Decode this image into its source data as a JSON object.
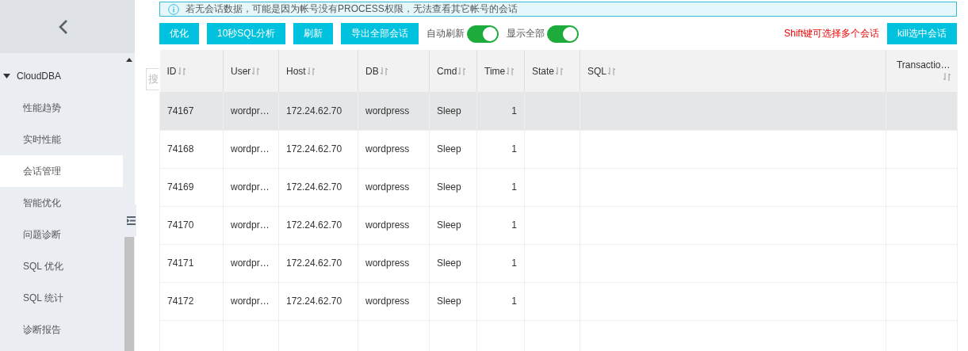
{
  "sidebar": {
    "group": {
      "label": "CloudDBA",
      "expanded": true
    },
    "items": [
      {
        "label": "性能趋势",
        "selected": false
      },
      {
        "label": "实时性能",
        "selected": false
      },
      {
        "label": "会话管理",
        "selected": true
      },
      {
        "label": "智能优化",
        "selected": false
      },
      {
        "label": "问题诊断",
        "selected": false
      },
      {
        "label": "SQL 优化",
        "selected": false
      },
      {
        "label": "SQL 统计",
        "selected": false
      },
      {
        "label": "诊断报告",
        "selected": false
      }
    ]
  },
  "search": {
    "placeholder": "搜"
  },
  "alert": {
    "text": "若无会话数据，可能是因为帐号没有PROCESS权限，无法查看其它帐号的会话"
  },
  "toolbar": {
    "buttons": [
      "优化",
      "10秒SQL分析",
      "刷新",
      "导出全部会话"
    ],
    "toggles": [
      {
        "label": "自动刷新",
        "on": true
      },
      {
        "label": "显示全部",
        "on": true
      }
    ],
    "hint": "Shift键可选择多个会话",
    "kill_button": "kill选中会话"
  },
  "table": {
    "columns": [
      "ID",
      "User",
      "Host",
      "DB",
      "Cmd",
      "Time",
      "State",
      "SQL",
      "Transactio…"
    ],
    "rows": [
      {
        "selected": true,
        "cells": [
          "74167",
          "wordpr…",
          "172.24.62.70",
          "wordpress",
          "Sleep",
          "1",
          "",
          "",
          ""
        ]
      },
      {
        "selected": false,
        "cells": [
          "74168",
          "wordpr…",
          "172.24.62.70",
          "wordpress",
          "Sleep",
          "1",
          "",
          "",
          ""
        ]
      },
      {
        "selected": false,
        "cells": [
          "74169",
          "wordpr…",
          "172.24.62.70",
          "wordpress",
          "Sleep",
          "1",
          "",
          "",
          ""
        ]
      },
      {
        "selected": false,
        "cells": [
          "74170",
          "wordpr…",
          "172.24.62.70",
          "wordpress",
          "Sleep",
          "1",
          "",
          "",
          ""
        ]
      },
      {
        "selected": false,
        "cells": [
          "74171",
          "wordpr…",
          "172.24.62.70",
          "wordpress",
          "Sleep",
          "1",
          "",
          "",
          ""
        ]
      },
      {
        "selected": false,
        "cells": [
          "74172",
          "wordpr…",
          "172.24.62.70",
          "wordpress",
          "Sleep",
          "1",
          "",
          "",
          ""
        ]
      }
    ]
  }
}
